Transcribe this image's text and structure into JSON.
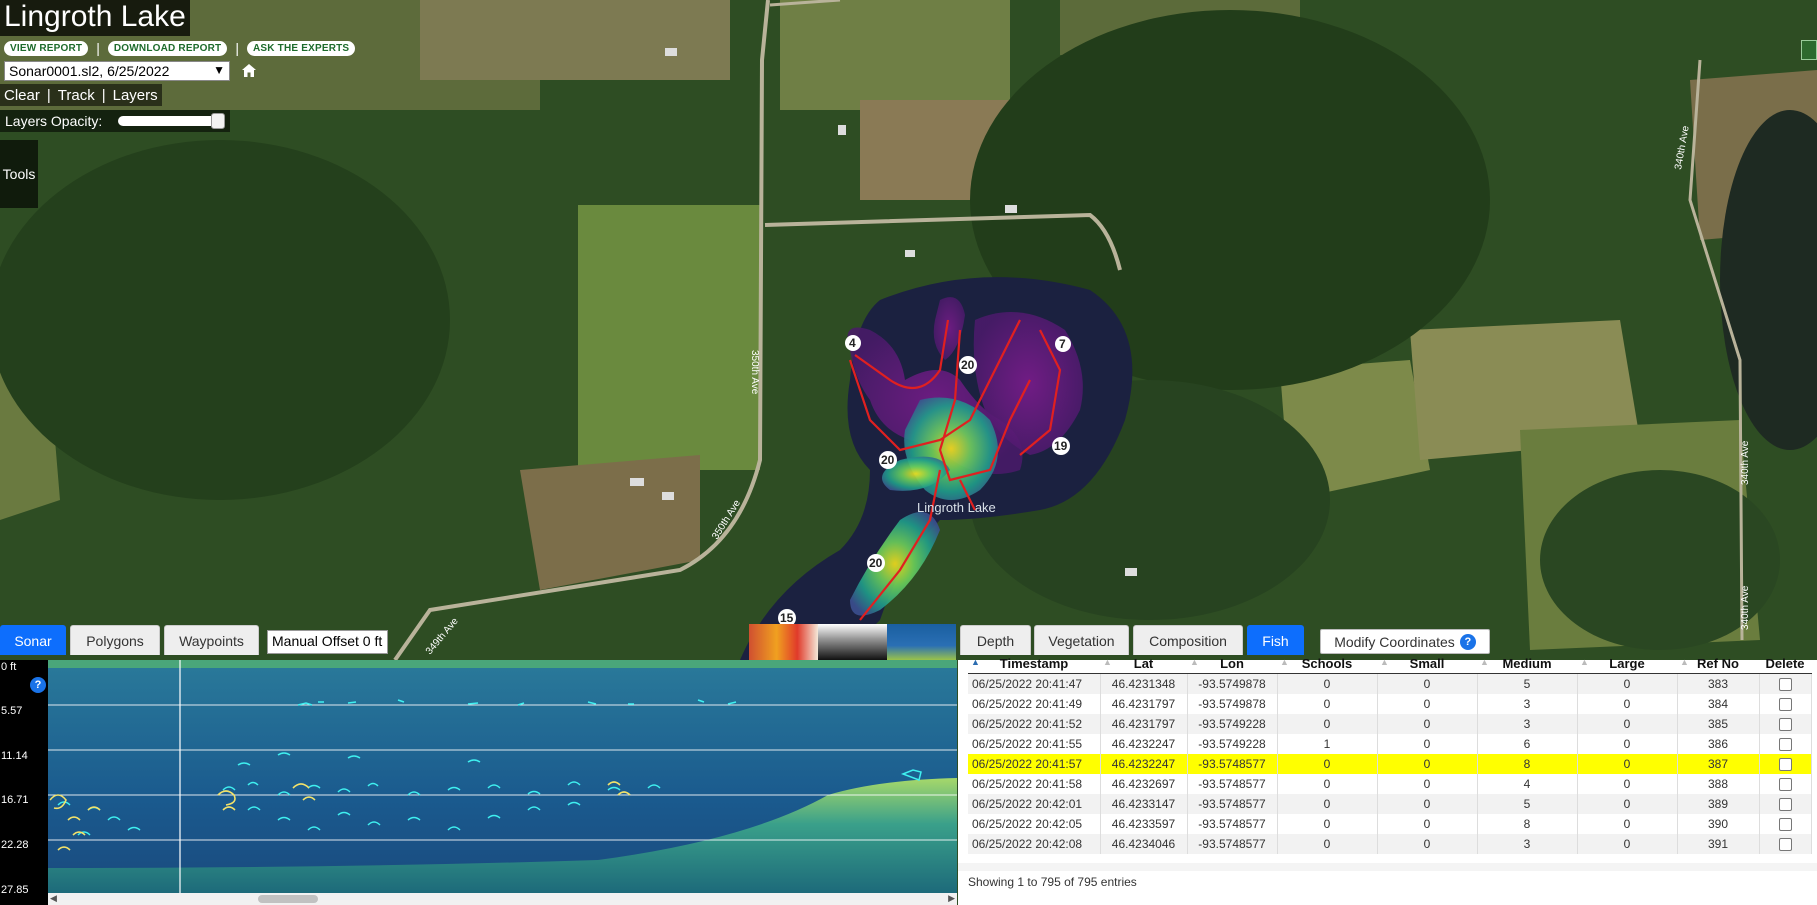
{
  "lake": {
    "title": "Lingroth Lake",
    "map_label": "Lingroth Lake"
  },
  "links": [
    {
      "label": "VIEW REPORT"
    },
    {
      "label": "DOWNLOAD REPORT"
    },
    {
      "label": "ASK THE EXPERTS"
    }
  ],
  "link_separator": "|",
  "file_select": {
    "value": "Sonar0001.sl2, 6/25/2022"
  },
  "menu": {
    "clear": "Clear",
    "track": "Track",
    "layers": "Layers",
    "separator": "|"
  },
  "opacity": {
    "label": "Layers Opacity:",
    "level": 1.0
  },
  "tools_label": "Tools",
  "roads": {
    "r350_top": "350th Ave",
    "r350_mid": "350th Ave",
    "r349": "349th Ave",
    "r340_top": "340th Ave",
    "r340_mid": "340th Ave",
    "r340_bot": "340th Ave"
  },
  "contours": {
    "c4": "4",
    "c7": "7",
    "c20a": "20",
    "c19": "19",
    "c20b": "20",
    "c20c": "20",
    "c15": "15"
  },
  "sonar_tabs": [
    {
      "label": "Sonar",
      "active": true
    },
    {
      "label": "Polygons",
      "active": false
    },
    {
      "label": "Waypoints",
      "active": false
    }
  ],
  "offset": {
    "value": "Manual Offset 0 ft"
  },
  "depth_ticks": [
    "0 ft",
    "5.57",
    "11.14",
    "16.71",
    "22.28",
    "27.85"
  ],
  "right_tabs": [
    {
      "label": "Depth",
      "active": false
    },
    {
      "label": "Vegetation",
      "active": false
    },
    {
      "label": "Composition",
      "active": false
    },
    {
      "label": "Fish",
      "active": true
    }
  ],
  "modify_button": {
    "label": "Modify Coordinates"
  },
  "table": {
    "columns": [
      "Timestamp",
      "Lat",
      "Lon",
      "Schools",
      "Small",
      "Medium",
      "Large",
      "Ref No",
      "Delete"
    ],
    "rows": [
      {
        "timestamp": "06/25/2022 20:41:47",
        "lat": "46.4231348",
        "lon": "-93.5749878",
        "schools": "0",
        "small": "0",
        "medium": "5",
        "large": "0",
        "ref": "383",
        "selected": false
      },
      {
        "timestamp": "06/25/2022 20:41:49",
        "lat": "46.4231797",
        "lon": "-93.5749878",
        "schools": "0",
        "small": "0",
        "medium": "3",
        "large": "0",
        "ref": "384",
        "selected": false
      },
      {
        "timestamp": "06/25/2022 20:41:52",
        "lat": "46.4231797",
        "lon": "-93.5749228",
        "schools": "0",
        "small": "0",
        "medium": "3",
        "large": "0",
        "ref": "385",
        "selected": false
      },
      {
        "timestamp": "06/25/2022 20:41:55",
        "lat": "46.4232247",
        "lon": "-93.5749228",
        "schools": "1",
        "small": "0",
        "medium": "6",
        "large": "0",
        "ref": "386",
        "selected": false
      },
      {
        "timestamp": "06/25/2022 20:41:57",
        "lat": "46.4232247",
        "lon": "-93.5748577",
        "schools": "0",
        "small": "0",
        "medium": "8",
        "large": "0",
        "ref": "387",
        "selected": true
      },
      {
        "timestamp": "06/25/2022 20:41:58",
        "lat": "46.4232697",
        "lon": "-93.5748577",
        "schools": "0",
        "small": "0",
        "medium": "4",
        "large": "0",
        "ref": "388",
        "selected": false
      },
      {
        "timestamp": "06/25/2022 20:42:01",
        "lat": "46.4233147",
        "lon": "-93.5748577",
        "schools": "0",
        "small": "0",
        "medium": "5",
        "large": "0",
        "ref": "389",
        "selected": false
      },
      {
        "timestamp": "06/25/2022 20:42:05",
        "lat": "46.4233597",
        "lon": "-93.5748577",
        "schools": "0",
        "small": "0",
        "medium": "8",
        "large": "0",
        "ref": "390",
        "selected": false
      },
      {
        "timestamp": "06/25/2022 20:42:08",
        "lat": "46.4234046",
        "lon": "-93.5748577",
        "schools": "0",
        "small": "0",
        "medium": "3",
        "large": "0",
        "ref": "391",
        "selected": false
      }
    ],
    "info": "Showing 1 to 795 of 795 entries"
  },
  "icons": {
    "home": "home-icon",
    "help": "help-icon",
    "expand": "expand-icon"
  },
  "colors": {
    "active_tab": "#0d6efd",
    "selected_row": "#ffff00",
    "link_text": "#1d6b2c",
    "track": "#e02020"
  }
}
